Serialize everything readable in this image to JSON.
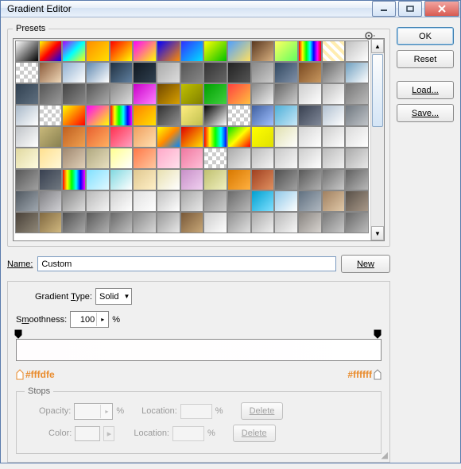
{
  "window": {
    "title": "Gradient Editor"
  },
  "presets": {
    "legend": "Presets",
    "swatches": [
      "linear-gradient(135deg,#fff,#000)",
      "linear-gradient(135deg,#ff0,#f00,#00f)",
      "linear-gradient(135deg,#a0f,#0ff,#ff0)",
      "linear-gradient(135deg,#ff8c00,#ffe000)",
      "linear-gradient(135deg,#f00,#ff0)",
      "linear-gradient(135deg,#f0f,#ff0)",
      "linear-gradient(135deg,#00f,#ff8c00)",
      "linear-gradient(135deg,#3030ff,#00e0ff)",
      "linear-gradient(135deg,#ff0,#00c000)",
      "linear-gradient(135deg,#50a0ff,#ffe060)",
      "linear-gradient(135deg,#5a3820,#d8b080)",
      "linear-gradient(135deg,#ffff60,#60ff60)",
      "linear-gradient(90deg,#f00,#ff0,#0f0,#0ff,#00f,#f0f,#f00)",
      "repeating-linear-gradient(45deg,#ffedb0 0 4px,#fff 4px 8px)",
      "linear-gradient(135deg,#c0c0c0,#fff)",
      "checker",
      "linear-gradient(135deg,#8a5a3a,#f0d8b8)",
      "linear-gradient(135deg,#90b0d0,#fff)",
      "linear-gradient(135deg,#6088b0,#fff)",
      "linear-gradient(135deg,#203040,#6080a0)",
      "linear-gradient(135deg,#101820,#304050)",
      "linear-gradient(135deg,#aaa,#ddd)",
      "linear-gradient(135deg,#555,#888)",
      "linear-gradient(135deg,#333,#666)",
      "linear-gradient(135deg,#222,#555)",
      "linear-gradient(135deg,#888,#ccc)",
      "linear-gradient(135deg,#304860,#8090a8)",
      "linear-gradient(135deg,#784820,#c89860)",
      "linear-gradient(135deg,#666,#ccc)",
      "linear-gradient(135deg,#70a0c0,#fff)",
      "linear-gradient(135deg,#304050,#607080)",
      "linear-gradient(135deg,#555,#999)",
      "linear-gradient(135deg,#444,#888)",
      "linear-gradient(135deg,#555,#aaa)",
      "linear-gradient(135deg,#888,#ddd)",
      "linear-gradient(135deg,#c800c8,#ff80ff)",
      "linear-gradient(135deg,#704800,#d8a000)",
      "linear-gradient(135deg,#c0c000,#808000)",
      "linear-gradient(135deg,#00a000,#40d040)",
      "linear-gradient(135deg,#ff4040,#ffc040)",
      "linear-gradient(135deg,#888,#eee)",
      "linear-gradient(135deg,#666,#ccc)",
      "linear-gradient(135deg,#ccc,#fff)",
      "linear-gradient(135deg,#bbb,#fff)",
      "linear-gradient(135deg,#777,#bbb)",
      "linear-gradient(135deg,#a8b8c8,#fff)",
      "checker",
      "linear-gradient(135deg,#ff0,#f00)",
      "linear-gradient(135deg,#f0f,#ff0)",
      "linear-gradient(90deg,#f00,#ff0,#0f0,#0ff,#00f,#f0f)",
      "linear-gradient(135deg,#ff8000,#ffe000)",
      "linear-gradient(135deg,#303030,#909090)",
      "linear-gradient(135deg,#ffee80,#c0c050)",
      "linear-gradient(135deg,#000,#fff)",
      "checker",
      "linear-gradient(135deg,#4060a0,#a0c0ff)",
      "linear-gradient(135deg,#50b0d8,#c8e8f8)",
      "linear-gradient(135deg,#384050,#808898)",
      "linear-gradient(135deg,#b0c0d0,#fff)",
      "linear-gradient(135deg,#707880,#c0c4c8)",
      "linear-gradient(135deg,#c0c4c8,#fff)",
      "linear-gradient(135deg,#c8b87a,#888050)",
      "linear-gradient(135deg,#c06020,#f0a050)",
      "linear-gradient(135deg,#e86030,#ffb060)",
      "linear-gradient(135deg,#ff3050,#ffa0c0)",
      "linear-gradient(135deg,#f0a060,#ffe0b0)",
      "linear-gradient(135deg,#ff0,#f80,#08f)",
      "linear-gradient(135deg,#e00000,#ffe000)",
      "linear-gradient(90deg,#f00,#ff0,#0f0,#0ff,#00f)",
      "linear-gradient(135deg,#00e000,#ff0,#f00)",
      "linear-gradient(135deg,#ffff00,#e0e000)",
      "linear-gradient(135deg,#e0e0b0,#fff)",
      "linear-gradient(135deg,#d4d4d4,#fff)",
      "linear-gradient(135deg,#ccc,#fff)",
      "linear-gradient(135deg,#dadada,#fff)",
      "linear-gradient(135deg,#e0d8a0,#fffce0)",
      "linear-gradient(135deg,#ffe090,#fff8d8)",
      "linear-gradient(135deg,#a08870,#e0d0b8)",
      "linear-gradient(135deg,#b0a880,#e8e0c0)",
      "linear-gradient(135deg,#ffff90,#fff)",
      "linear-gradient(135deg,#ff7848,#ffc8a0)",
      "linear-gradient(135deg,#ffa8c8,#ffe0ec)",
      "linear-gradient(135deg,#f078a0,#ffc0d8)",
      "checker",
      "linear-gradient(135deg,#aaa,#eee)",
      "linear-gradient(135deg,#bbb,#f4f4f4)",
      "linear-gradient(135deg,#c8c8c8,#f8f8f8)",
      "linear-gradient(135deg,#ccc,#fff)",
      "linear-gradient(135deg,#bbb,#f0f0f0)",
      "linear-gradient(135deg,#aaa,#e8e8e8)",
      "linear-gradient(135deg,#585858,#a0a0a0)",
      "linear-gradient(135deg,#384050,#707880)",
      "linear-gradient(90deg,#f00,#ff0,#0f0,#0ff,#00f,#f0f)",
      "linear-gradient(135deg,#80e0ff,#e0f8ff)",
      "linear-gradient(135deg,#80d8e0,#fff)",
      "linear-gradient(135deg,#e0c890,#fff0c8)",
      "linear-gradient(135deg,#e8e0b0,#fff)",
      "linear-gradient(135deg,#c890c8,#f0d0f0)",
      "linear-gradient(135deg,#c0c070,#f0f0c0)",
      "linear-gradient(135deg,#d87800,#ffb040)",
      "linear-gradient(135deg,#a04020,#e09060)",
      "linear-gradient(135deg,#505050,#a0a0a0)",
      "linear-gradient(135deg,#585858,#b0b0b0)",
      "linear-gradient(135deg,#707070,#c8c8c8)",
      "linear-gradient(135deg,#606060,#b8b8b8)",
      "linear-gradient(135deg,#505860,#a0a8b0)",
      "linear-gradient(135deg,#808084,#d0d0d4)",
      "linear-gradient(135deg,#888,#ddd)",
      "linear-gradient(135deg,#b8b8b8,#f4f4f4)",
      "linear-gradient(135deg,#d0d0d0,#fff)",
      "linear-gradient(135deg,#e0e0e0,#fff)",
      "linear-gradient(135deg,#c0c0c0,#fff)",
      "linear-gradient(135deg,#a8a8a8,#e8e8e8)",
      "linear-gradient(135deg,#888,#ccc)",
      "linear-gradient(135deg,#6a6a6a,#b8b8b8)",
      "linear-gradient(135deg,#00a0d0,#80e0ff)",
      "linear-gradient(135deg,#90c8e8,#fff)",
      "linear-gradient(135deg,#607080,#b0b8c0)",
      "linear-gradient(135deg,#a08060,#e0c8a8)",
      "linear-gradient(135deg,#585048,#a89888)",
      "linear-gradient(135deg,#484038,#908878)",
      "linear-gradient(135deg,#806840,#d0b880)",
      "linear-gradient(135deg,#505050,#a8a8a8)",
      "linear-gradient(135deg,#585858,#b0b0b0)",
      "linear-gradient(135deg,#686868,#c0c0c0)",
      "linear-gradient(135deg,#888,#d8d8d8)",
      "linear-gradient(135deg,#989898,#e8e8e8)",
      "linear-gradient(135deg,#785838,#c8a878)",
      "linear-gradient(135deg,#ccc,#fff)",
      "linear-gradient(135deg,#909090,#e0e0e0)",
      "linear-gradient(135deg,#aaa,#f0f0f0)",
      "linear-gradient(135deg,#b8b8b8,#f8f8f8)",
      "linear-gradient(135deg,#888480,#d8d4d0)",
      "linear-gradient(135deg,#787878,#c8c8c8)",
      "linear-gradient(135deg,#686868,#bcbcbc)"
    ]
  },
  "buttons": {
    "ok": "OK",
    "reset": "Reset",
    "load": "Load...",
    "save": "Save...",
    "new": "New"
  },
  "name": {
    "label": "Name:",
    "value": "Custom"
  },
  "gradient": {
    "type_label": "Gradient Type:",
    "type_value": "Solid",
    "smoothness_label": "Smoothness:",
    "smoothness_value": "100",
    "percent": "%",
    "left_hex": "#fffdfe",
    "right_hex": "#ffffff"
  },
  "stops": {
    "legend": "Stops",
    "opacity_label": "Opacity:",
    "location_label": "Location:",
    "color_label": "Color:",
    "delete_label": "Delete",
    "percent": "%"
  }
}
